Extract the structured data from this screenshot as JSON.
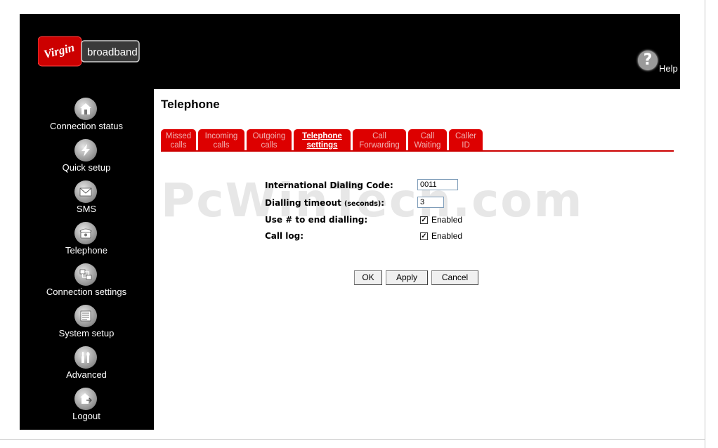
{
  "header": {
    "logo_brand": "Virgin",
    "logo_text": "broadband",
    "help_label": "Help"
  },
  "sidebar": {
    "items": [
      {
        "label": "Connection status",
        "icon": "house-icon"
      },
      {
        "label": "Quick setup",
        "icon": "lightning-icon"
      },
      {
        "label": "SMS",
        "icon": "envelope-icon"
      },
      {
        "label": "Telephone",
        "icon": "telephone-icon"
      },
      {
        "label": "Connection settings",
        "icon": "network-icon"
      },
      {
        "label": "System setup",
        "icon": "document-icon"
      },
      {
        "label": "Advanced",
        "icon": "tools-icon"
      },
      {
        "label": "Logout",
        "icon": "logout-house-icon"
      }
    ]
  },
  "main": {
    "title": "Telephone",
    "watermark": "PcWinTech.com",
    "tabs": [
      {
        "line1": "Missed",
        "line2": "calls"
      },
      {
        "line1": "Incoming",
        "line2": "calls"
      },
      {
        "line1": "Outgoing",
        "line2": "calls"
      },
      {
        "line1": "Telephone",
        "line2": "settings"
      },
      {
        "line1": "Call",
        "line2": "Forwarding"
      },
      {
        "line1": "Call",
        "line2": "Waiting"
      },
      {
        "line1": "Caller",
        "line2": "ID"
      }
    ],
    "form": {
      "intl_code_label": "International Dialing Code:",
      "intl_code_value": "0011",
      "timeout_label": "Dialling timeout",
      "timeout_unit": "(seconds)",
      "timeout_colon": ":",
      "timeout_value": "3",
      "hash_label": "Use # to end dialling:",
      "hash_checkbox_label": "Enabled",
      "hash_checked": true,
      "calllog_label": "Call log:",
      "calllog_checkbox_label": "Enabled",
      "calllog_checked": true
    },
    "buttons": {
      "ok": "OK",
      "apply": "Apply",
      "cancel": "Cancel"
    }
  },
  "colors": {
    "brand_red": "#dd0000",
    "sidebar_bg": "#000000"
  }
}
